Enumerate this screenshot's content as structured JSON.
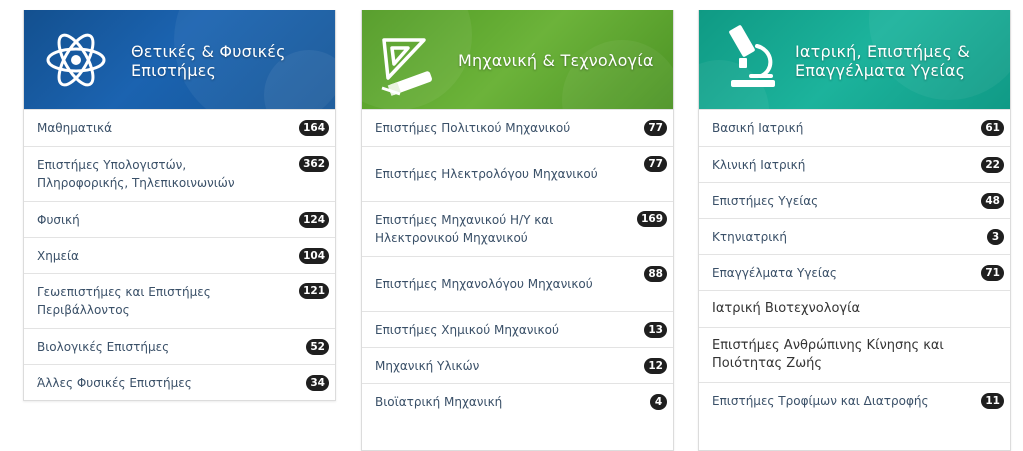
{
  "cards": [
    {
      "title": "Θετικές & Φυσικές Επιστήμες",
      "title_lines": [
        "Θετικές & Φυσικές",
        "Επιστήμες"
      ],
      "icon": "atom-icon",
      "color": "#1b5fa8",
      "items": [
        {
          "label": "Μαθηματικά",
          "count": "164"
        },
        {
          "label": "Επιστήμες Υπολογιστών, Πληροφορικής, Τηλεπικοινωνιών",
          "count": "362"
        },
        {
          "label": "Φυσική",
          "count": "124"
        },
        {
          "label": "Χημεία",
          "count": "104"
        },
        {
          "label": "Γεωεπιστήμες και Επιστήμες Περιβάλλοντος",
          "count": "121"
        },
        {
          "label": "Βιολογικές Επιστήμες",
          "count": "52"
        },
        {
          "label": "Άλλες Φυσικές Επιστήμες",
          "count": "34"
        }
      ]
    },
    {
      "title": "Μηχανική & Τεχνολογία",
      "icon": "drafting-tools-icon",
      "color": "#5ea82c",
      "items": [
        {
          "label": "Επιστήμες Πολιτικού Μηχανικού",
          "count": "77"
        },
        {
          "label": "Επιστήμες Ηλεκτρολόγου Μηχανικού",
          "count": "77"
        },
        {
          "label": "Επιστήμες Μηχανικού Η/Υ και Ηλεκτρονικού Μηχανικού",
          "count": "169"
        },
        {
          "label": "Επιστήμες Μηχανολόγου Μηχανικού",
          "count": "88"
        },
        {
          "label": "Επιστήμες Χημικού Μηχανικού",
          "count": "13"
        },
        {
          "label": "Μηχανική Υλικών",
          "count": "12"
        },
        {
          "label": "Βιοϊατρική Μηχανική",
          "count": "4"
        }
      ]
    },
    {
      "title": "Ιατρική, Επιστήμες & Επαγγέλματα Υγείας",
      "title_lines": [
        "Ιατρική, Επιστήμες &",
        "Επαγγέλματα Υγείας"
      ],
      "icon": "microscope-icon",
      "color": "#17a58f",
      "items": [
        {
          "label": "Βασική Ιατρική",
          "count": "61"
        },
        {
          "label": "Κλινική Ιατρική",
          "count": "22"
        },
        {
          "label": "Επιστήμες Υγείας",
          "count": "48"
        },
        {
          "label": "Κτηνιατρική",
          "count": "3"
        },
        {
          "label": "Επαγγέλματα Υγείας",
          "count": "71"
        },
        {
          "label": "Ιατρική Βιοτεχνολογία",
          "count": ""
        },
        {
          "label": "Επιστήμες Ανθρώπινης Κίνησης και Ποιότητας Ζωής",
          "count": ""
        },
        {
          "label": "Επιστήμες Τροφίμων και Διατροφής",
          "count": "11"
        }
      ]
    }
  ]
}
